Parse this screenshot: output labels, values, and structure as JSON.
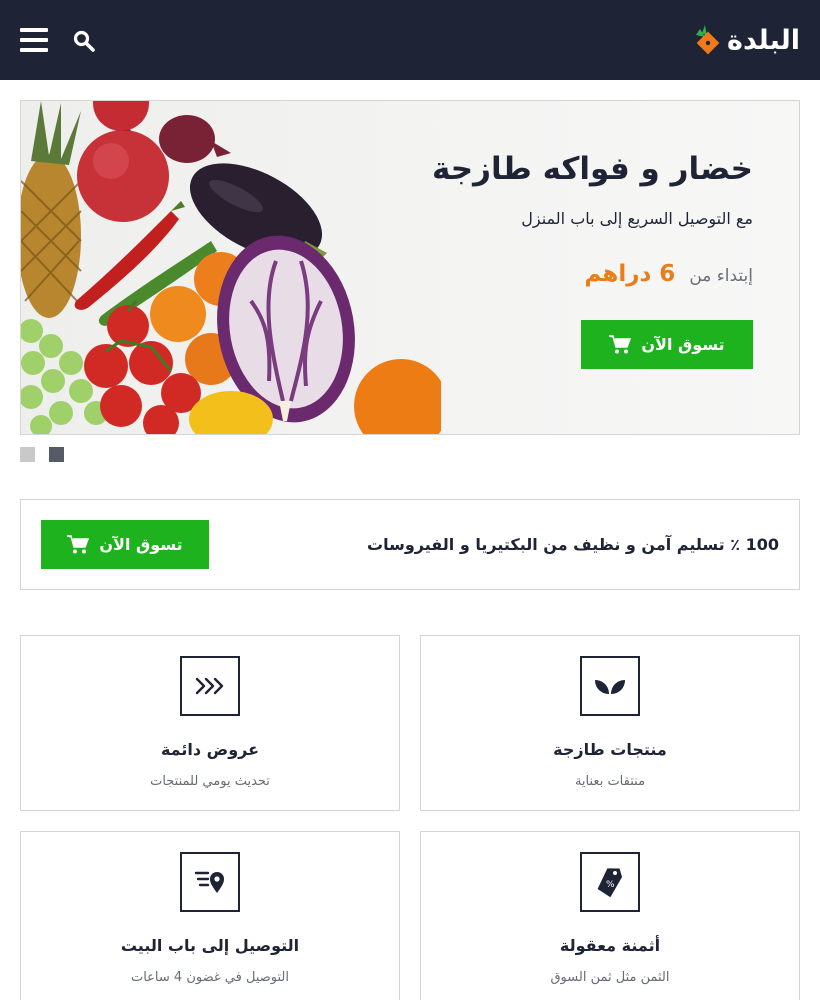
{
  "brand": {
    "name": "البلدة",
    "accent": "#ea7d19",
    "header_bg": "#1e2436",
    "button_green": "#1eb31e"
  },
  "header": {
    "menu_icon": "hamburger-menu-icon",
    "search_icon": "search-icon"
  },
  "hero": {
    "title": "خضار و فواكه طازجة",
    "subtitle": "مع التوصيل السريع إلى باب المنزل",
    "price_prefix": "إبتداء من",
    "price_value": "6 دراهم",
    "button_label": "تسوق الآن",
    "slides_count": 2,
    "active_slide": 2
  },
  "promo": {
    "text": "100 ٪ تسليم آمن و نظيف من البكتيريا و الفيروسات",
    "button_label": "تسوق الآن"
  },
  "features": [
    {
      "title": "منتجات طازجة",
      "subtitle": "منتقات بعناية",
      "icon": "leaf-icon"
    },
    {
      "title": "عروض دائمة",
      "subtitle": "تحديث يومي للمنتجات",
      "icon": "triple-chevron-icon"
    },
    {
      "title": "أثمنة معقولة",
      "subtitle": "الثمن مثل ثمن السوق",
      "icon": "price-tag-icon"
    },
    {
      "title": "التوصيل إلى باب البيت",
      "subtitle": "التوصيل في غضون 4 ساعات",
      "icon": "delivery-location-icon"
    }
  ]
}
